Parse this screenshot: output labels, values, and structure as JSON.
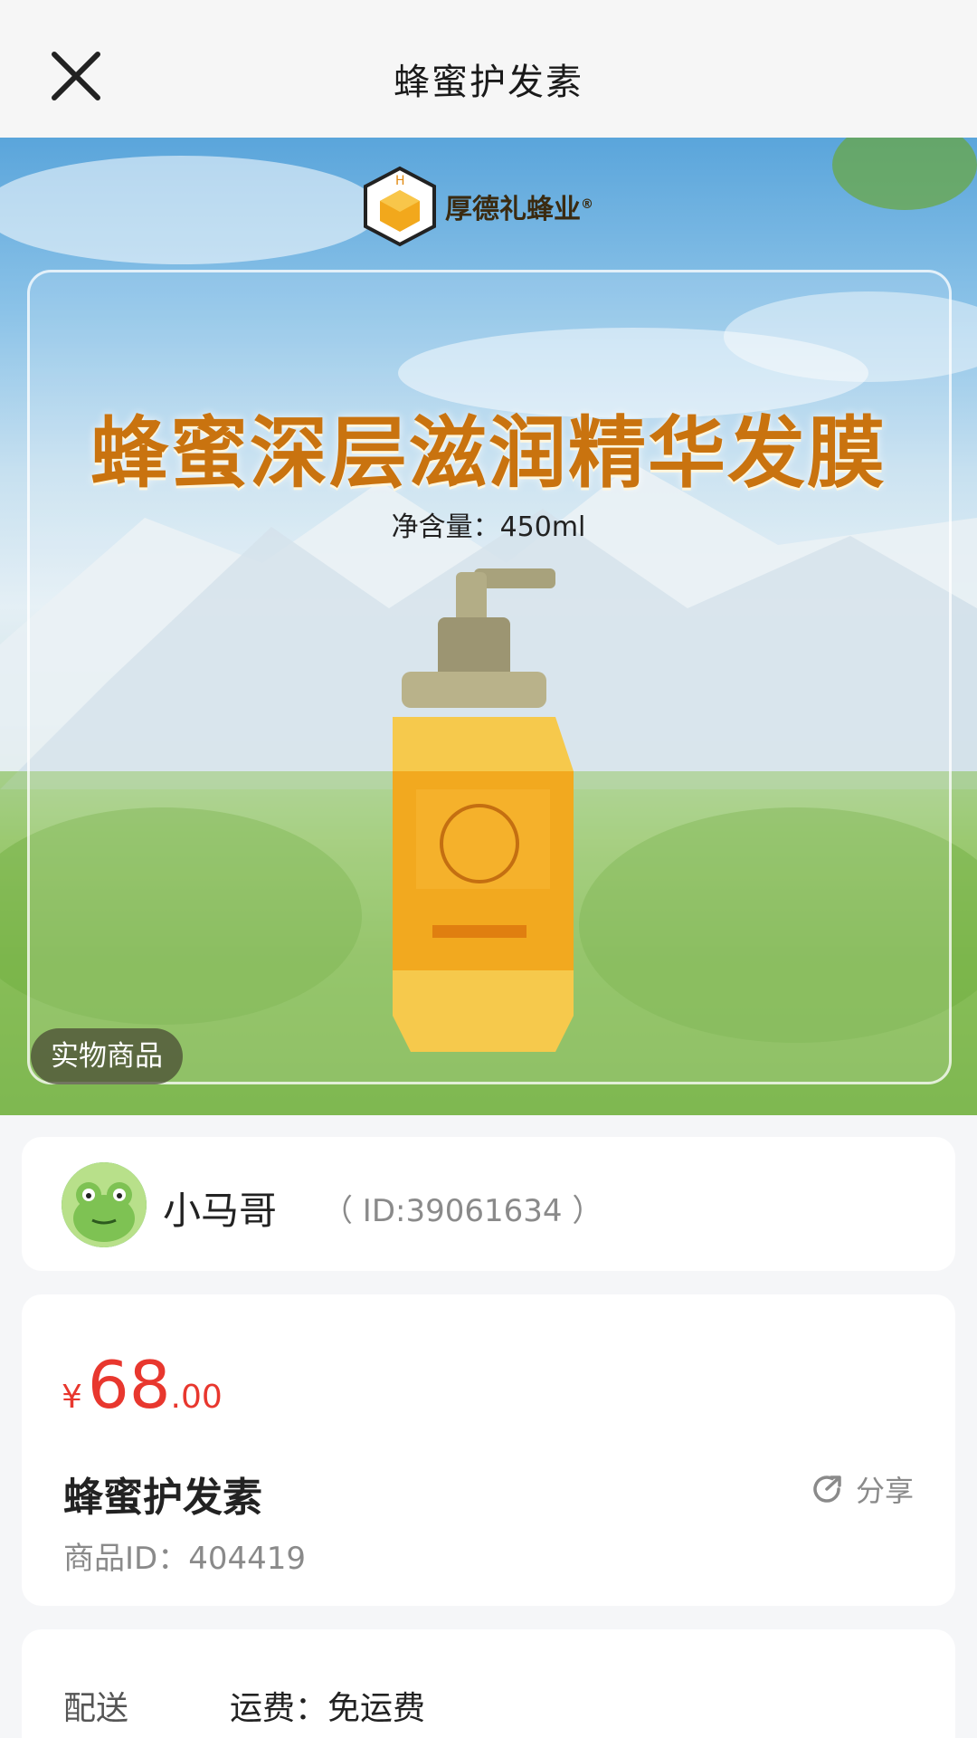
{
  "nav": {
    "title": "蜂蜜护发素",
    "close_icon": "close-icon"
  },
  "banner": {
    "brand_name": "厚德礼蜂业",
    "registered_mark": "®",
    "headline": "蜂蜜深层滋润精华发膜",
    "net_content": "净含量：450ml",
    "badge": "实物商品"
  },
  "seller": {
    "name": "小马哥",
    "id_text": "（ ID:39061634 ）"
  },
  "product": {
    "currency": "¥",
    "price_int": "68",
    "price_dec": ".00",
    "price_color": "#e8372e",
    "name": "蜂蜜护发素",
    "share_label": "分享",
    "share_icon": "share-icon",
    "product_id": "商品ID：404419"
  },
  "delivery": {
    "label": "配送",
    "value": "运费：免运费"
  }
}
